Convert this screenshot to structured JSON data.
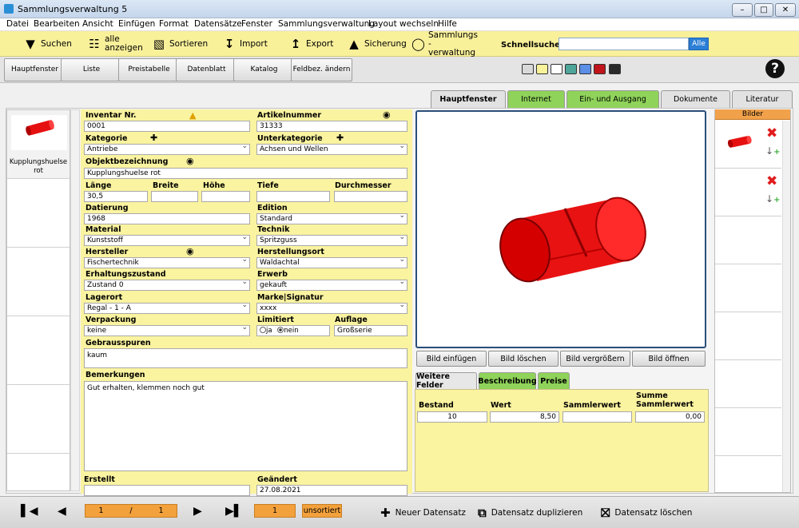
{
  "window": {
    "title": "Sammlungsverwaltung 5",
    "min": "–",
    "max": "□",
    "close": "✕"
  },
  "menu": [
    "Datei",
    "Bearbeiten",
    "Ansicht",
    "Einfügen",
    "Format",
    "Datensätze",
    "Fenster",
    "Sammlungsverwaltung",
    "Layout wechseln",
    "Hilfe"
  ],
  "toolbar": {
    "search": "Suchen",
    "show_all": "alle anzeigen",
    "sort": "Sortieren",
    "import": "Import",
    "export": "Export",
    "backup": "Sicherung",
    "collections": "Sammlungs -verwaltung",
    "quick_search_label": "Schnellsuche",
    "quick_search_value": "",
    "quick_search_all": "Alle"
  },
  "nav": {
    "buttons": [
      "Hauptfenster",
      "Liste",
      "Preistabelle",
      "Datenblatt",
      "Katalog",
      "Feldbez. ändern"
    ],
    "swatches": [
      "#d9d9d9",
      "#f8f29a",
      "#ffffff",
      "#4fa59a",
      "#5b8ee6",
      "#c0151a",
      "#2a2a2a"
    ],
    "help": "?"
  },
  "tabs": [
    "Hauptfenster",
    "Internet",
    "Ein- und Ausgang",
    "Dokumente",
    "Literatur"
  ],
  "thumbs": [
    {
      "label": "Kupplungshuelse rot"
    }
  ],
  "form": {
    "inventar_label": "Inventar Nr.",
    "inventar_value": "0001",
    "artikel_label": "Artikelnummer",
    "artikel_value": "31333",
    "kategorie_label": "Kategorie",
    "kategorie_value": "Antriebe",
    "unterkategorie_label": "Unterkategorie",
    "unterkategorie_value": "Achsen und Wellen",
    "objekt_label": "Objektbezeichnung",
    "objekt_value": "Kupplungshuelse rot",
    "laenge_label": "Länge",
    "laenge_value": "30,5",
    "breite_label": "Breite",
    "breite_value": "",
    "hoehe_label": "Höhe",
    "hoehe_value": "",
    "tiefe_label": "Tiefe",
    "tiefe_value": "",
    "durchmesser_label": "Durchmesser",
    "durchmesser_value": "",
    "datierung_label": "Datierung",
    "datierung_value": "1968",
    "edition_label": "Edition",
    "edition_value": "Standard",
    "material_label": "Material",
    "material_value": "Kunststoff",
    "technik_label": "Technik",
    "technik_value": "Spritzguss",
    "hersteller_label": "Hersteller",
    "hersteller_value": "Fischertechnik",
    "herstellungsort_label": "Herstellungsort",
    "herstellungsort_value": "Waldachtal",
    "erhaltung_label": "Erhaltungszustand",
    "erhaltung_value": "Zustand 0",
    "erwerb_label": "Erwerb",
    "erwerb_value": "gekauft",
    "lagerort_label": "Lagerort",
    "lagerort_value": "Regal - 1 - A",
    "marke_label": "Marke|Signatur",
    "marke_value": "xxxx",
    "verpackung_label": "Verpackung",
    "verpackung_value": "keine",
    "limitiert_label": "Limitiert",
    "limitiert_ja": "ja",
    "limitiert_nein": "nein",
    "auflage_label": "Auflage",
    "auflage_value": "Großserie",
    "gebrauch_label": "Gebrausspuren",
    "gebrauch_value": "kaum",
    "bemerkungen_label": "Bemerkungen",
    "bemerkungen_value": "Gut erhalten, klemmen noch gut",
    "erstellt_label": "Erstellt",
    "erstellt_value": "",
    "geaendert_label": "Geändert",
    "geaendert_value": "27.08.2021"
  },
  "image_buttons": [
    "Bild einfügen",
    "Bild löschen",
    "Bild vergrößern",
    "Bild öffnen"
  ],
  "subtabs": [
    "Weitere Felder",
    "Beschreibung",
    "Preise"
  ],
  "prices": {
    "bestand_label": "Bestand",
    "bestand_value": "10",
    "wert_label": "Wert",
    "wert_value": "8,50",
    "sammlerwert_label": "Sammlerwert",
    "sammlerwert_value": "",
    "summe_label": "Summe Sammlerwert",
    "summe_value": "0,00"
  },
  "bilder": {
    "header": "Bilder"
  },
  "status": {
    "current": "1",
    "sep": "/",
    "total": "1",
    "record": "1",
    "sort_state": "unsortiert",
    "new_record": "Neuer Datensatz",
    "duplicate": "Datensatz duplizieren",
    "delete": "Datensatz löschen"
  },
  "colors": {
    "toolbar_bg": "#f9f09a",
    "tab_green": "#8fd35a",
    "accent_orange": "#f3a13c"
  }
}
